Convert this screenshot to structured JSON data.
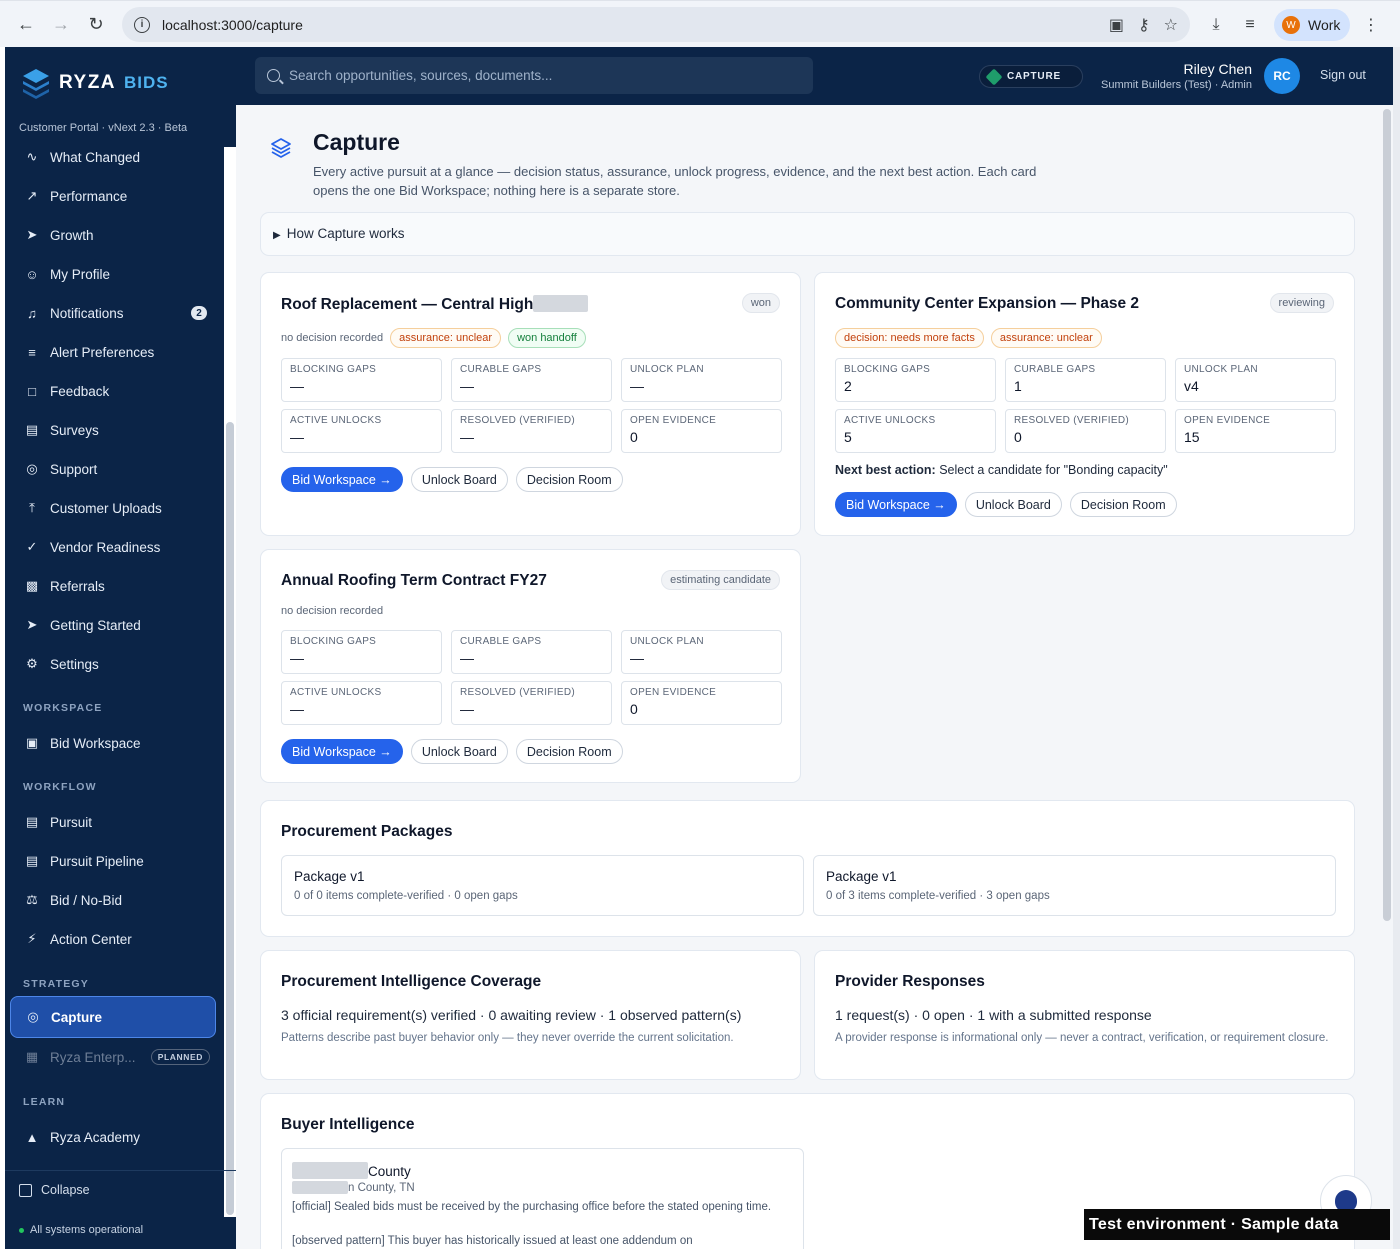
{
  "browser": {
    "url": "localhost:3000/capture",
    "profile_label": "Work",
    "profile_initial": "W"
  },
  "brand": {
    "name": "RYZA",
    "name_accent": "BIDS",
    "portal_version": "Customer Portal · vNext 2.3 · Beta"
  },
  "sidebar": {
    "items": [
      {
        "label": "What Changed",
        "icon": "pulse-icon"
      },
      {
        "label": "Performance",
        "icon": "trending-up-icon"
      },
      {
        "label": "Growth",
        "icon": "rocket-icon"
      },
      {
        "label": "My Profile",
        "icon": "user-circle-icon"
      },
      {
        "label": "Notifications",
        "icon": "bell-icon",
        "badge": "2"
      },
      {
        "label": "Alert Preferences",
        "icon": "sliders-icon"
      },
      {
        "label": "Feedback",
        "icon": "message-icon"
      },
      {
        "label": "Surveys",
        "icon": "clipboard-icon"
      },
      {
        "label": "Support",
        "icon": "lifebuoy-icon"
      },
      {
        "label": "Customer Uploads",
        "icon": "upload-icon"
      },
      {
        "label": "Vendor Readiness",
        "icon": "check-circle-icon"
      },
      {
        "label": "Referrals",
        "icon": "gift-icon"
      },
      {
        "label": "Getting Started",
        "icon": "rocket-icon"
      },
      {
        "label": "Settings",
        "icon": "gear-icon"
      }
    ],
    "sections": {
      "workspace": "WORKSPACE",
      "workflow": "WORKFLOW",
      "strategy": "STRATEGY",
      "learn": "LEARN"
    },
    "workspace_items": [
      {
        "label": "Bid Workspace",
        "icon": "briefcase-icon"
      }
    ],
    "workflow_items": [
      {
        "label": "Pursuit",
        "icon": "kanban-icon"
      },
      {
        "label": "Pursuit Pipeline",
        "icon": "kanban-icon"
      },
      {
        "label": "Bid / No-Bid",
        "icon": "scale-icon"
      },
      {
        "label": "Action Center",
        "icon": "bolt-icon"
      }
    ],
    "strategy_items": [
      {
        "label": "Capture",
        "icon": "target-icon",
        "active": true
      },
      {
        "label": "Ryza Enterp...",
        "icon": "building-icon",
        "tag": "PLANNED"
      }
    ],
    "learn_items": [
      {
        "label": "Ryza Academy",
        "icon": "graduation-cap-icon"
      }
    ],
    "collapse_label": "Collapse",
    "status_text": "All systems operational"
  },
  "topbar": {
    "search_placeholder": "Search opportunities, sources, documents...",
    "capture_pill": "CAPTURE",
    "user_name": "Riley Chen",
    "user_org": "Summit Builders (Test) · Admin",
    "avatar_initials": "RC",
    "signout": "Sign out"
  },
  "page": {
    "title": "Capture",
    "description": "Every active pursuit at a glance — decision status, assurance, unlock progress, evidence, and the next best action. Each card opens the one Bid Workspace; nothing here is a separate store.",
    "howto": "How Capture works"
  },
  "metric_labels": [
    "BLOCKING GAPS",
    "CURABLE GAPS",
    "UNLOCK PLAN",
    "ACTIVE UNLOCKS",
    "RESOLVED (VERIFIED)",
    "OPEN EVIDENCE"
  ],
  "buttons": {
    "bid_workspace": "Bid Workspace →",
    "unlock_board": "Unlock Board",
    "decision_room": "Decision Room"
  },
  "pursuits": [
    {
      "title": "Roof Replacement — Central High",
      "status": "won",
      "decision": "no decision recorded",
      "chips": [
        {
          "label": "assurance: unclear",
          "tone": "amber"
        },
        {
          "label": "won handoff",
          "tone": "green"
        }
      ],
      "values": [
        "—",
        "—",
        "—",
        "—",
        "—",
        "0"
      ]
    },
    {
      "title": "Community Center Expansion — Phase 2",
      "status": "reviewing",
      "chips": [
        {
          "label": "decision: needs more facts",
          "tone": "amber"
        },
        {
          "label": "assurance: unclear",
          "tone": "amber"
        }
      ],
      "values": [
        "2",
        "1",
        "v4",
        "5",
        "0",
        "15"
      ],
      "next_best_action_label": "Next best action:",
      "next_best_action": "Select a candidate for \"Bonding capacity\""
    },
    {
      "title": "Annual Roofing Term Contract FY27",
      "status": "estimating candidate",
      "decision": "no decision recorded",
      "values": [
        "—",
        "—",
        "—",
        "—",
        "—",
        "0"
      ]
    }
  ],
  "procurement_packages": {
    "title": "Procurement Packages",
    "items": [
      {
        "name": "Package v1",
        "detail": "0 of 0 items complete-verified · 0 open gaps"
      },
      {
        "name": "Package v1",
        "detail": "0 of 3 items complete-verified · 3 open gaps"
      }
    ]
  },
  "intel_coverage": {
    "title": "Procurement Intelligence Coverage",
    "stat": "3 official requirement(s) verified · 0 awaiting review · 1 observed pattern(s)",
    "note": "Patterns describe past buyer behavior only — they never override the current solicitation."
  },
  "provider_responses": {
    "title": "Provider Responses",
    "stat": "1 request(s) · 0 open · 1 with a submitted response",
    "note": "A provider response is informational only — never a contract, verification, or requirement closure."
  },
  "buyer_intel": {
    "title": "Buyer Intelligence",
    "buyer_name": "County",
    "buyer_location": "n County, TN",
    "lines": [
      "[official] Sealed bids must be received by the purchasing office before the stated opening time.",
      "[observed pattern] This buyer has historically issued at least one addendum on"
    ]
  },
  "test_banner": "Test environment · Sample data"
}
